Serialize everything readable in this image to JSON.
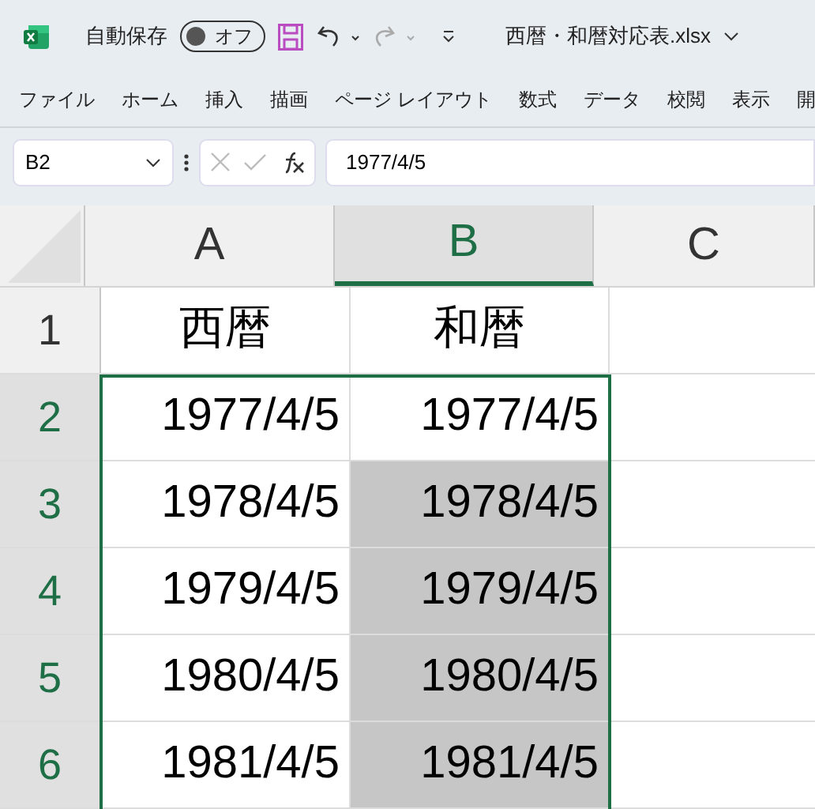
{
  "title_bar": {
    "autosave_label": "自動保存",
    "autosave_toggle": {
      "label": "オフ",
      "on": false
    },
    "filename": "西暦・和暦対応表.xlsx"
  },
  "ribbon_tabs": [
    {
      "label": "ファイル",
      "selected": false
    },
    {
      "label": "ホーム",
      "selected": false
    },
    {
      "label": "挿入",
      "selected": false
    },
    {
      "label": "描画",
      "selected": false
    },
    {
      "label": "ページ レイアウト",
      "selected": false
    },
    {
      "label": "数式",
      "selected": false
    },
    {
      "label": "データ",
      "selected": false
    },
    {
      "label": "校閲",
      "selected": false
    },
    {
      "label": "表示",
      "selected": false
    },
    {
      "label": "開",
      "selected": false
    }
  ],
  "formula_bar": {
    "name_box": "B2",
    "formula": "1977/4/5"
  },
  "columns": [
    {
      "label": "A",
      "selected": false
    },
    {
      "label": "B",
      "selected": true
    },
    {
      "label": "C",
      "selected": false
    }
  ],
  "rows": [
    {
      "header": "1",
      "selected": false,
      "cells": [
        {
          "text": "西暦",
          "selected": false
        },
        {
          "text": "和暦",
          "selected": false
        }
      ]
    },
    {
      "header": "2",
      "selected": true,
      "cells": [
        {
          "text": "1977/4/5",
          "selected": false
        },
        {
          "text": "1977/4/5",
          "selected": false
        }
      ]
    },
    {
      "header": "3",
      "selected": true,
      "cells": [
        {
          "text": "1978/4/5",
          "selected": false
        },
        {
          "text": "1978/4/5",
          "selected": true
        }
      ]
    },
    {
      "header": "4",
      "selected": true,
      "cells": [
        {
          "text": "1979/4/5",
          "selected": false
        },
        {
          "text": "1979/4/5",
          "selected": true
        }
      ]
    },
    {
      "header": "5",
      "selected": true,
      "cells": [
        {
          "text": "1980/4/5",
          "selected": false
        },
        {
          "text": "1980/4/5",
          "selected": true
        }
      ]
    },
    {
      "header": "6",
      "selected": true,
      "cells": [
        {
          "text": "1981/4/5",
          "selected": false
        },
        {
          "text": "1981/4/5",
          "selected": true
        }
      ]
    }
  ]
}
